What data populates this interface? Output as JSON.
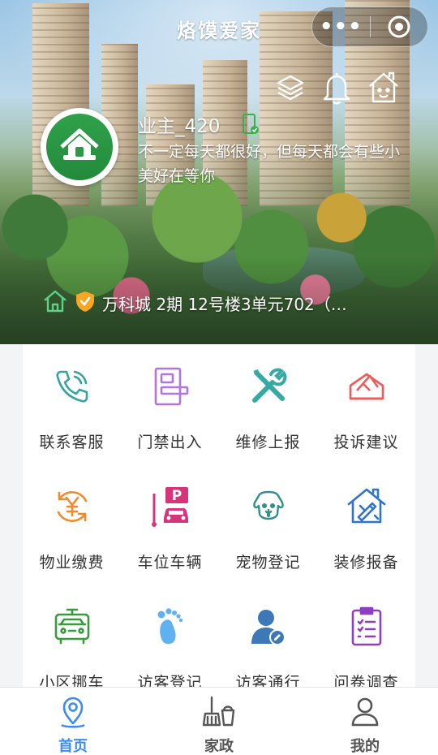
{
  "app": {
    "title": "烙馍爱家"
  },
  "header": {
    "more_icon": "more-dots-icon",
    "close_icon": "target-circle-icon",
    "action_icons": [
      "layers-icon",
      "bell-icon",
      "house-face-icon"
    ]
  },
  "user": {
    "name": "业主_420",
    "motto": "不一定每天都很好，但每天都会有些小美好在等你",
    "address": "万科城 2期 12号楼3单元702（…"
  },
  "services": [
    {
      "label": "联系客服",
      "icon": "phone-icon",
      "color": "#35a3a3"
    },
    {
      "label": "门禁出入",
      "icon": "door-access-icon",
      "color": "#b174e0"
    },
    {
      "label": "维修上报",
      "icon": "tools-icon",
      "color": "#35aaa5"
    },
    {
      "label": "投诉建议",
      "icon": "envelope-icon",
      "color": "#ef5b5b"
    },
    {
      "label": "物业缴费",
      "icon": "yuan-cycle-icon",
      "color": "#f28a2b"
    },
    {
      "label": "车位车辆",
      "icon": "parking-car-icon",
      "color": "#d6357a"
    },
    {
      "label": "宠物登记",
      "icon": "dog-icon",
      "color": "#2f8e8e"
    },
    {
      "label": "装修报备",
      "icon": "renovation-house-icon",
      "color": "#2f74c8"
    },
    {
      "label": "小区挪车",
      "icon": "move-car-icon",
      "color": "#3a9a3e"
    },
    {
      "label": "访客登记",
      "icon": "footprint-icon",
      "color": "#5fb2ef"
    },
    {
      "label": "访客通行",
      "icon": "visitor-pass-icon",
      "color": "#3d78b8"
    },
    {
      "label": "问卷调查",
      "icon": "survey-icon",
      "color": "#8e3fc0"
    }
  ],
  "tabs": [
    {
      "label": "首页",
      "icon": "location-pin-icon",
      "active": true
    },
    {
      "label": "家政",
      "icon": "broom-bucket-icon",
      "active": false
    },
    {
      "label": "我的",
      "icon": "person-icon",
      "active": false
    }
  ],
  "colors": {
    "tab_active": "#3b8cf0",
    "tab_inactive": "#555555",
    "badge_green": "#35b34a",
    "shield_orange": "#f5a623"
  }
}
